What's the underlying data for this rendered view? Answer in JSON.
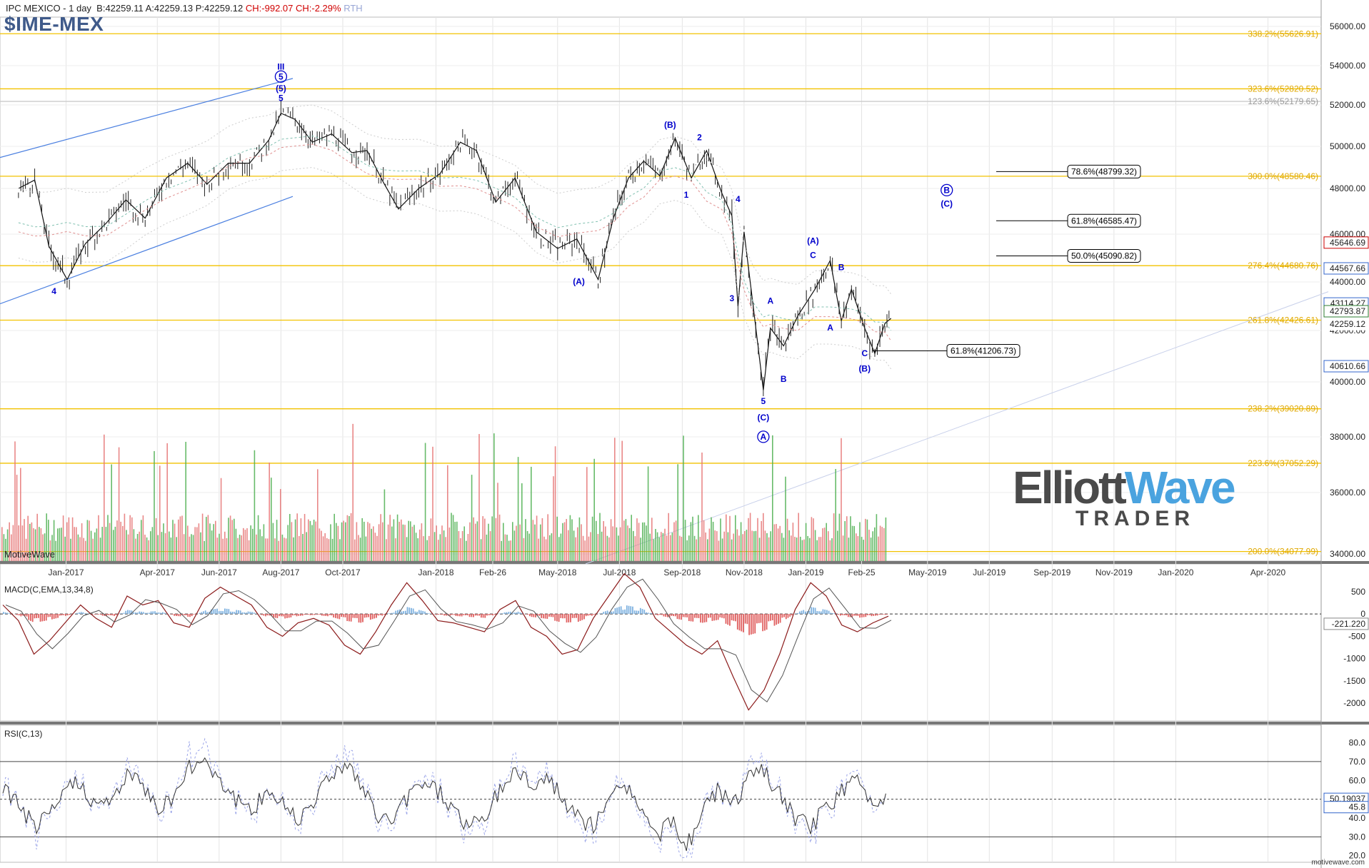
{
  "header": {
    "title": "IPC MEXICO - 1 day",
    "bid": "B:42259.11",
    "ask": "A:42259.13",
    "price": "P:42259.12",
    "change": "CH:-992.07",
    "change_pct": "CH:-2.29%",
    "session": "RTH",
    "symbol": "$IME-MEX"
  },
  "watermark": "MotiveWave",
  "footer_site": "motivewave.com",
  "logo": {
    "line1a": "Elliott",
    "line1b": "Wave",
    "line2": "TRADER"
  },
  "colors": {
    "fib_line": "#f2c200",
    "fib_text": "#e0a800",
    "wave_label": "#0000cc",
    "channel": "#4a7fe0",
    "volume_up": "#4caf50",
    "volume_down": "#e57373",
    "macd_line": "#8b1a1a",
    "signal_line": "#555555",
    "hist_pos": "#7fb2e0",
    "hist_neg": "#e06060",
    "price_tag_blue": "#3366cc",
    "price_tag_red": "#cc0000"
  },
  "chart_data": [
    {
      "type": "line",
      "title": "IPC MEXICO - 1 day",
      "x_ticks": [
        "Jan-2017",
        "Apr-2017",
        "Jun-2017",
        "Aug-2017",
        "Oct-2017",
        "Jan-2018",
        "Feb-26",
        "May-2018",
        "Jul-2018",
        "Sep-2018",
        "Nov-2018",
        "Jan-2019",
        "Feb-25",
        "May-2019",
        "Jul-2019",
        "Sep-2019",
        "Nov-2019",
        "Jan-2020",
        "Apr-2020"
      ],
      "y_ticks": [
        "56000.00",
        "54000.00",
        "52000.00",
        "50000.00",
        "48000.00",
        "46000.00",
        "44000.00",
        "42000.00",
        "40000.00",
        "38000.00",
        "36000.00",
        "34000.00"
      ],
      "ylim": [
        33800,
        56800
      ],
      "series": [
        {
          "x": [
            "2016-11-15",
            "2016-12-01",
            "2016-12-15",
            "2017-01-02",
            "2017-01-20",
            "2017-02-10",
            "2017-03-01",
            "2017-03-20",
            "2017-04-10",
            "2017-05-01",
            "2017-05-20",
            "2017-06-10",
            "2017-07-01",
            "2017-07-20",
            "2017-08-01",
            "2017-08-15",
            "2017-09-01",
            "2017-09-20",
            "2017-10-10",
            "2017-10-25",
            "2017-11-10",
            "2017-11-25",
            "2017-12-15",
            "2018-01-05",
            "2018-01-25",
            "2018-02-10",
            "2018-03-01",
            "2018-03-20",
            "2018-04-10",
            "2018-05-01",
            "2018-05-20",
            "2018-06-10",
            "2018-06-25",
            "2018-07-10",
            "2018-07-25",
            "2018-08-10",
            "2018-08-25",
            "2018-09-10",
            "2018-09-25",
            "2018-10-10",
            "2018-10-20",
            "2018-10-26",
            "2018-11-01",
            "2018-11-10",
            "2018-11-20",
            "2018-11-27",
            "2018-12-10",
            "2018-12-24",
            "2019-01-10",
            "2019-01-25",
            "2019-02-05",
            "2019-02-15",
            "2019-02-28",
            "2019-03-10",
            "2019-03-20",
            "2019-03-26"
          ],
          "values": [
            48000,
            48400,
            45500,
            44100,
            45600,
            46500,
            47500,
            46700,
            48500,
            49200,
            48200,
            49200,
            49200,
            50300,
            51600,
            51300,
            50200,
            50600,
            49700,
            49800,
            48300,
            47100,
            48000,
            48700,
            50200,
            49800,
            47400,
            48500,
            46100,
            45400,
            45800,
            44100,
            46700,
            48500,
            49300,
            48600,
            50400,
            48500,
            49800,
            47800,
            46800,
            43000,
            46100,
            43000,
            39700,
            42100,
            41400,
            42600,
            43700,
            44900,
            42400,
            43700,
            42100,
            41100,
            42300,
            42500
          ]
        }
      ],
      "fib_levels": [
        {
          "label": "338.2%(55626.91)",
          "value": 55626.91
        },
        {
          "label": "323.6%(52820.52)",
          "value": 52820.52
        },
        {
          "label": "123.6%(52179.65)",
          "value": 52179.65
        },
        {
          "label": "300.0%(48580.46)",
          "value": 48580.46
        },
        {
          "label": "276.4%(44680.76)",
          "value": 44680.76
        },
        {
          "label": "261.8%(42426.61)",
          "value": 42426.61
        },
        {
          "label": "238.2%(39020.89)",
          "value": 39020.89
        },
        {
          "label": "223.6%(37052.29)",
          "value": 37052.29
        },
        {
          "label": "200.0%(34077.99)",
          "value": 34077.99
        }
      ],
      "target_boxes": [
        {
          "label": "78.6%(48799.32)",
          "value": 48799.32
        },
        {
          "label": "61.8%(46585.47)",
          "value": 46585.47
        },
        {
          "label": "50.0%(45090.82)",
          "value": 45090.82
        },
        {
          "label": "61.8%(41206.73)",
          "value": 41206.73
        }
      ],
      "price_tags": [
        {
          "label": "45646.69",
          "value": 45646.69,
          "style": "red"
        },
        {
          "label": "44567.66",
          "value": 44567.66,
          "style": "blue"
        },
        {
          "label": "43114.27",
          "value": 43114.27,
          "style": "blue"
        },
        {
          "label": "42793.87",
          "value": 42793.87,
          "style": "green"
        },
        {
          "label": "42259.12",
          "value": 42259.12,
          "style": "plain"
        },
        {
          "label": "40610.66",
          "value": 40610.66,
          "style": "blue"
        }
      ],
      "wave_labels": [
        {
          "x": "2016-12-20",
          "y": 43500,
          "text": "4"
        },
        {
          "x": "2017-08-01",
          "y": 53800,
          "text": "III"
        },
        {
          "x": "2017-08-01",
          "y": 53300,
          "text": "5",
          "circled": true
        },
        {
          "x": "2017-08-01",
          "y": 52700,
          "text": "(5)"
        },
        {
          "x": "2017-08-01",
          "y": 52200,
          "text": "5"
        },
        {
          "x": "2018-05-22",
          "y": 43900,
          "text": "(A)"
        },
        {
          "x": "2018-08-20",
          "y": 50900,
          "text": "(B)"
        },
        {
          "x": "2018-09-05",
          "y": 47600,
          "text": "1"
        },
        {
          "x": "2018-09-18",
          "y": 50300,
          "text": "2"
        },
        {
          "x": "2018-10-20",
          "y": 43200,
          "text": "3"
        },
        {
          "x": "2018-10-26",
          "y": 47400,
          "text": "4"
        },
        {
          "x": "2018-11-20",
          "y": 39200,
          "text": "5"
        },
        {
          "x": "2018-11-20",
          "y": 38600,
          "text": "(C)"
        },
        {
          "x": "2018-11-20",
          "y": 37900,
          "text": "A",
          "circled": true
        },
        {
          "x": "2018-11-27",
          "y": 43100,
          "text": "A"
        },
        {
          "x": "2018-12-10",
          "y": 40000,
          "text": "B"
        },
        {
          "x": "2019-01-08",
          "y": 45600,
          "text": "(A)"
        },
        {
          "x": "2019-01-08",
          "y": 45000,
          "text": "C"
        },
        {
          "x": "2019-01-25",
          "y": 42000,
          "text": "A"
        },
        {
          "x": "2019-02-05",
          "y": 44500,
          "text": "B"
        },
        {
          "x": "2019-02-28",
          "y": 41000,
          "text": "C"
        },
        {
          "x": "2019-02-28",
          "y": 40400,
          "text": "(B)"
        },
        {
          "x": "2019-05-20",
          "y": 47800,
          "text": "B",
          "circled": true
        },
        {
          "x": "2019-05-20",
          "y": 47200,
          "text": "(C)"
        }
      ]
    },
    {
      "type": "bar",
      "title": "",
      "series": [
        {
          "values": [
            5,
            6,
            4,
            7,
            5,
            3,
            6,
            8,
            5,
            4,
            9,
            5,
            6,
            4,
            5,
            7,
            3,
            6,
            5,
            8,
            4,
            5,
            6,
            7
          ]
        }
      ]
    },
    {
      "type": "line",
      "title": "MACD(C,EMA,13,34,8)",
      "y_ticks": [
        "500",
        "0",
        "-500",
        "-1000",
        "-1500",
        "-2000"
      ],
      "ylim": [
        -2300,
        800
      ],
      "value_tags": [
        {
          "label": "0",
          "value": 0
        },
        {
          "label": "-221.220",
          "value": -221.22
        }
      ],
      "series": [
        {
          "name": "MACD",
          "values": [
            200,
            -150,
            -900,
            -600,
            -200,
            200,
            -100,
            -300,
            400,
            200,
            300,
            -200,
            -300,
            350,
            600,
            400,
            200,
            -300,
            -500,
            -200,
            -100,
            -250,
            -700,
            -900,
            -400,
            200,
            700,
            300,
            -150,
            -200,
            -300,
            -400,
            100,
            300,
            -300,
            -500,
            -900,
            -800,
            -100,
            400,
            900,
            600,
            -100,
            -400,
            -700,
            -900,
            -600,
            -1400,
            -2150,
            -1700,
            -900,
            100,
            700,
            400,
            -250,
            -400,
            -200,
            -50
          ]
        }
      ]
    },
    {
      "type": "line",
      "title": "RSI(C,13)",
      "y_ticks": [
        "80.0",
        "70.0",
        "60.0",
        "50.0",
        "40.0",
        "30.0",
        "20.0"
      ],
      "ylim": [
        18,
        84
      ],
      "value_tags": [
        {
          "label": "50.19037",
          "value": 50.19
        },
        {
          "label": "45.8",
          "value": 45.8
        }
      ],
      "series": [
        {
          "name": "RSI",
          "values": [
            55,
            48,
            35,
            40,
            55,
            60,
            45,
            50,
            62,
            58,
            45,
            52,
            66,
            72,
            60,
            50,
            42,
            55,
            48,
            40,
            50,
            62,
            70,
            58,
            42,
            38,
            50,
            60,
            55,
            45,
            35,
            40,
            55,
            66,
            58,
            62,
            50,
            40,
            35,
            48,
            60,
            45,
            30,
            38,
            25,
            42,
            55,
            48,
            60,
            65,
            52,
            40,
            35,
            45,
            55,
            60,
            48,
            52
          ]
        }
      ]
    }
  ]
}
